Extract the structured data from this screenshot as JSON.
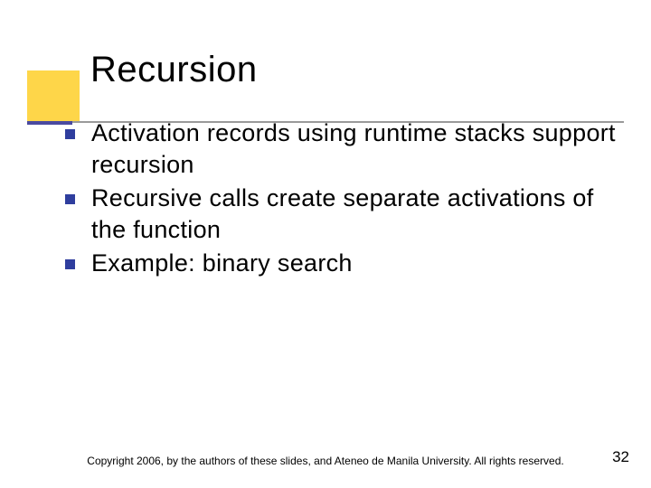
{
  "slide": {
    "title": "Recursion",
    "bullets": [
      "Activation records using runtime stacks support recursion",
      "Recursive calls create separate activations of the function",
      "Example:  binary search"
    ],
    "copyright": "Copyright 2006, by the authors of these slides, and Ateneo de Manila University. All rights reserved.",
    "page_number": "32"
  }
}
